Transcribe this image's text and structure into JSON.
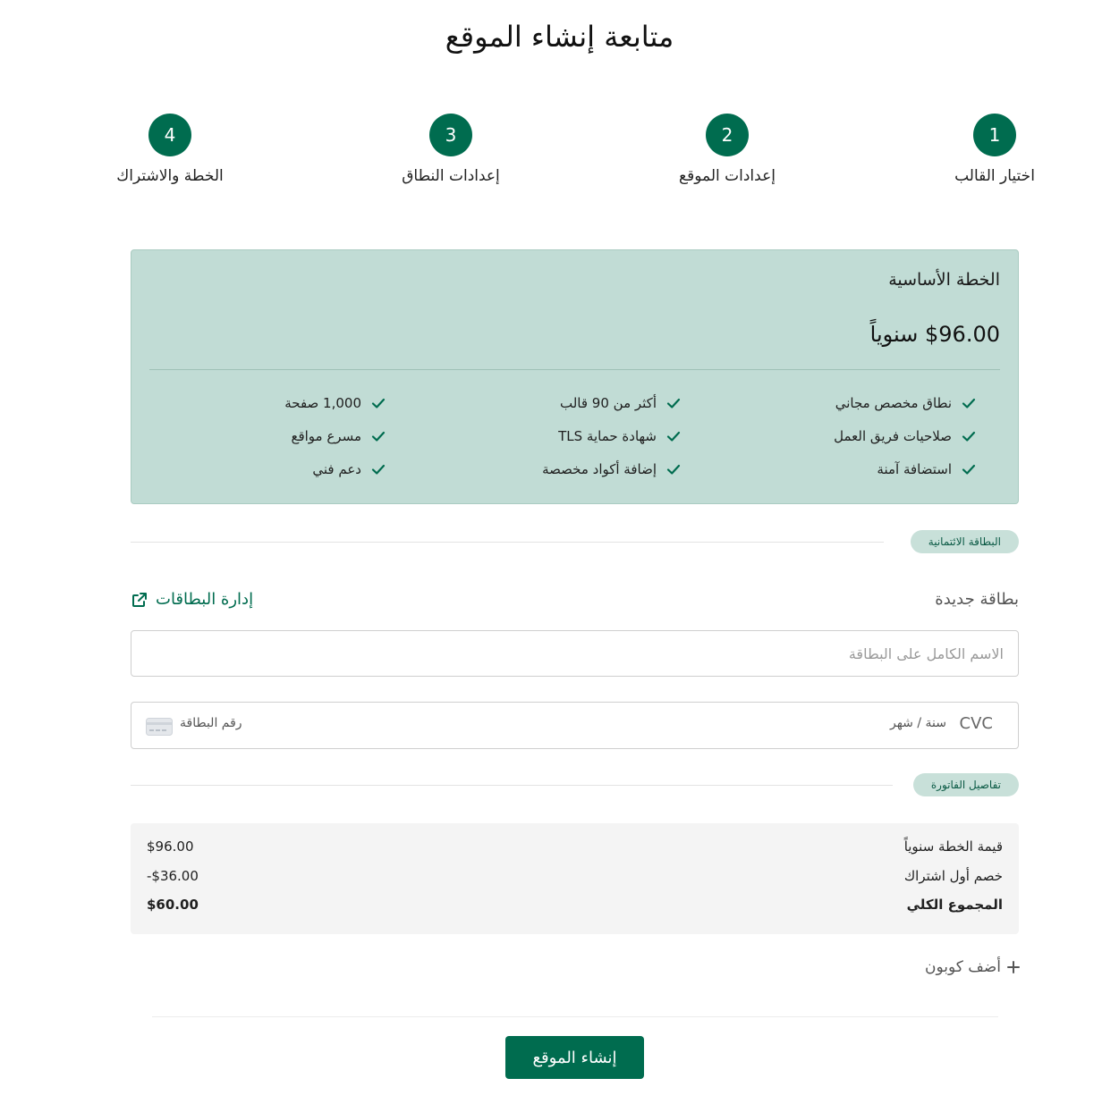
{
  "page": {
    "title": "متابعة إنشاء الموقع"
  },
  "steps": [
    {
      "number": "1",
      "label": "اختيار القالب"
    },
    {
      "number": "2",
      "label": "إعدادات الموقع"
    },
    {
      "number": "3",
      "label": "إعدادات النطاق"
    },
    {
      "number": "4",
      "label": "الخطة والاشتراك"
    }
  ],
  "plan": {
    "name": "الخطة الأساسية",
    "price": "$96.00 سنوياً",
    "features": [
      "نطاق مخصص مجاني",
      "أكثر من 90 قالب",
      "1,000 صفحة",
      "صلاحيات فريق العمل",
      "شهادة حماية TLS",
      "مسرع مواقع",
      "استضافة آمنة",
      "إضافة أكواد مخصصة",
      "دعم فني"
    ]
  },
  "credit_section": {
    "badge": "البطاقة الائتمانية"
  },
  "payment": {
    "new_card_label": "بطاقة جديدة",
    "manage_cards_label": "إدارة البطاقات",
    "name_placeholder": "الاسم الكامل على البطاقة",
    "card_number_placeholder": "رقم البطاقة",
    "expiry_placeholder": "سنة / شهر",
    "cvc_placeholder": "CVC"
  },
  "invoice_section": {
    "badge": "تفاصيل الفاتورة"
  },
  "invoice": {
    "rows": [
      {
        "label": "قيمة الخطة سنوياً",
        "value": "$96.00"
      },
      {
        "label": "خصم أول اشتراك",
        "value": "-$36.00"
      },
      {
        "label": "المجموع الكلي",
        "value": "$60.00"
      }
    ]
  },
  "coupon": {
    "label": "أضف كوبون"
  },
  "submit": {
    "label": "إنشاء الموقع"
  },
  "colors": {
    "brand": "#006c4f",
    "plan_bg": "#c1dcd5",
    "badge_bg": "#c8e0d9",
    "invoice_bg": "#f4f4f4"
  },
  "icons": {
    "check": "check-icon",
    "external": "external-link-icon",
    "card": "credit-card-icon",
    "plus": "plus-icon"
  }
}
